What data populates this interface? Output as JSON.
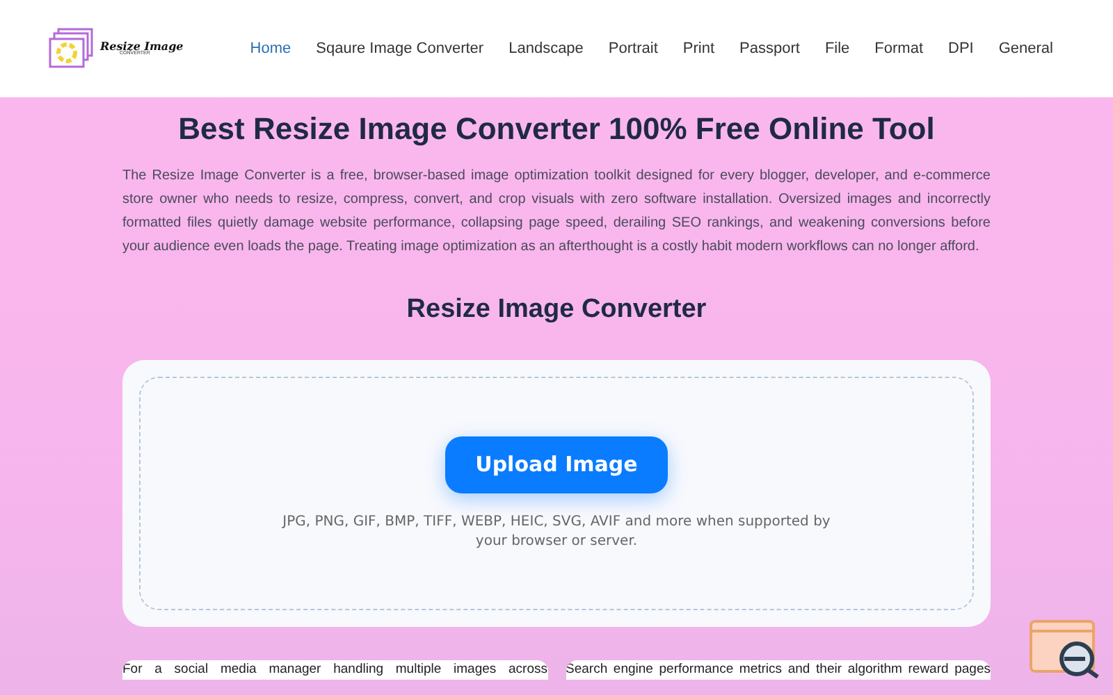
{
  "header": {
    "logo": {
      "title": "Resize Image",
      "subtitle": "CONVERTER"
    },
    "nav": [
      {
        "label": "Home",
        "selected": true
      },
      {
        "label": "Sqaure Image Converter",
        "selected": false
      },
      {
        "label": "Landscape",
        "selected": false
      },
      {
        "label": "Portrait",
        "selected": false
      },
      {
        "label": "Print",
        "selected": false
      },
      {
        "label": "Passport",
        "selected": false
      },
      {
        "label": "File",
        "selected": false
      },
      {
        "label": "Format",
        "selected": false
      },
      {
        "label": "DPI",
        "selected": false
      },
      {
        "label": "General",
        "selected": false
      }
    ]
  },
  "main": {
    "title": "Best Resize Image Converter 100% Free Online Tool",
    "intro": "The Resize Image Converter is a free, browser-based image optimization toolkit designed for every blogger, developer, and e-commerce store owner who needs to resize, compress, convert, and crop visuals with zero software installation. Oversized images and incorrectly formatted files quietly damage website performance, collapsing page speed, derailing SEO rankings, and weakening conversions before your audience even loads the page. Treating image optimization as an afterthought is a costly habit modern workflows can no longer afford.",
    "tool_heading": "Resize Image Converter",
    "upload": {
      "button": "Upload Image",
      "hint": "JPG, PNG, GIF, BMP, TIFF, WEBP, HEIC, SVG, AVIF and more when supported by your browser or server."
    },
    "cards": [
      "For a social media manager handling multiple images across",
      "Search engine performance metrics and their algorithm reward pages"
    ]
  }
}
